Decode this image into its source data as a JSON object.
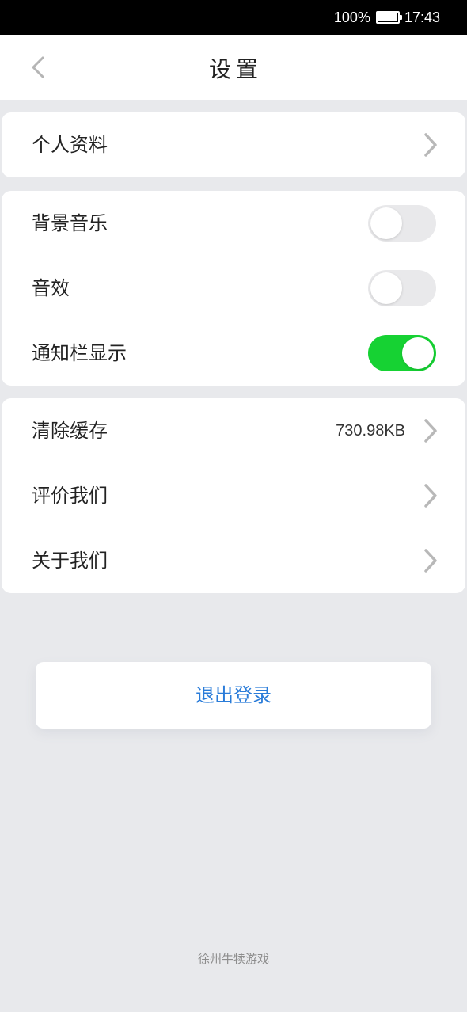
{
  "status_bar": {
    "battery_text": "100%",
    "battery_level": 1.0,
    "time": "17:43"
  },
  "header": {
    "title": "设置",
    "back_icon": "chevron-left-icon"
  },
  "profile": {
    "label": "个人资料",
    "icon": "chevron-right-icon"
  },
  "toggles": [
    {
      "label": "背景音乐",
      "on": false
    },
    {
      "label": "音效",
      "on": false
    },
    {
      "label": "通知栏显示",
      "on": true
    }
  ],
  "misc": [
    {
      "label": "清除缓存",
      "value": "730.98KB"
    },
    {
      "label": "评价我们"
    },
    {
      "label": "关于我们"
    }
  ],
  "logout": {
    "label": "退出登录"
  },
  "footer": {
    "text": "徐州牛犊游戏"
  },
  "colors": {
    "accent": "#2a7cd9",
    "toggle_on": "#16d233",
    "toggle_off": "#e9e9eb",
    "background": "#e8e9ec"
  }
}
